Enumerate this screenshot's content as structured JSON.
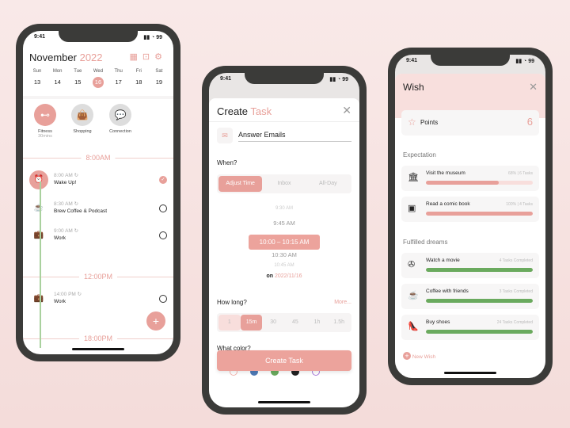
{
  "colors": {
    "accent": "#e8a09a",
    "green": "#6aaa5e",
    "frame": "#3b3b39"
  },
  "status_time": "9:41",
  "battery": "99",
  "calendar": {
    "month": "November",
    "year": "2022",
    "days": [
      {
        "d": "Sun",
        "n": "13"
      },
      {
        "d": "Mon",
        "n": "14"
      },
      {
        "d": "Tue",
        "n": "15"
      },
      {
        "d": "Wed",
        "n": "16"
      },
      {
        "d": "Thu",
        "n": "17"
      },
      {
        "d": "Fri",
        "n": "18"
      },
      {
        "d": "Sat",
        "n": "19"
      }
    ],
    "selected_day": "16",
    "habits": [
      {
        "label": "Fitness",
        "sub": "30mins",
        "icon": "dumbbell-icon"
      },
      {
        "label": "Shopping",
        "icon": "shopping-bag-icon"
      },
      {
        "label": "Connection",
        "icon": "chat-icon"
      }
    ],
    "dividers": [
      "8:00AM",
      "12:00PM",
      "18:00PM"
    ],
    "tasks": [
      {
        "time": "8:00 AM",
        "name": "Wake Up!",
        "icon": "alarm-icon",
        "done": true
      },
      {
        "time": "8:30 AM",
        "name": "Brew Coffee & Podcast",
        "icon": "coffee-icon",
        "done": false
      },
      {
        "time": "9:00 AM",
        "name": "Work",
        "icon": "briefcase-icon",
        "done": false
      },
      {
        "time": "14:00 PM",
        "name": "Work",
        "icon": "briefcase-icon",
        "done": false
      }
    ]
  },
  "create": {
    "title_a": "Create",
    "title_b": "Task",
    "task_name": "Answer Emails",
    "when_label": "When?",
    "when_tabs": [
      "Adjust Time",
      "Inbox",
      "All-Day"
    ],
    "times": [
      "9:30 AM",
      "9:45 AM",
      "10:00 – 10:15 AM",
      "10:30 AM",
      "10:45 AM"
    ],
    "on_label": "on",
    "date": "2022/11/16",
    "howlong_label": "How long?",
    "more": "More...",
    "durations": [
      "1",
      "15m",
      "30",
      "45",
      "1h",
      "1.5h"
    ],
    "selected_duration": "15m",
    "color_label": "What color?",
    "color_options": [
      "#f3b7b1",
      "#4e79b5",
      "#6aaa5e",
      "#222222",
      "#a97bd9"
    ],
    "button": "Create Task"
  },
  "wish": {
    "title": "Wish",
    "points_label": "Points",
    "points": "6",
    "expectation_label": "Expectation",
    "expectations": [
      {
        "name": "Visit the museum",
        "meta": "68% | 6 Tasks",
        "progress": 68,
        "icon": "museum-icon"
      },
      {
        "name": "Read a comic book",
        "meta": "100% | 4 Tasks",
        "progress": 100,
        "icon": "book-icon"
      }
    ],
    "fulfilled_label": "Fulfilled dreams",
    "fulfilled": [
      {
        "name": "Watch a movie",
        "meta": "4 Tasks Completed",
        "icon": "film-reel-icon"
      },
      {
        "name": "Coffee with friends",
        "meta": "3 Tasks Completed",
        "icon": "coffee-icon"
      },
      {
        "name": "Buy shoes",
        "meta": "24 Tasks Completed",
        "icon": "shoe-icon"
      }
    ],
    "new_wish": "New Wish"
  }
}
